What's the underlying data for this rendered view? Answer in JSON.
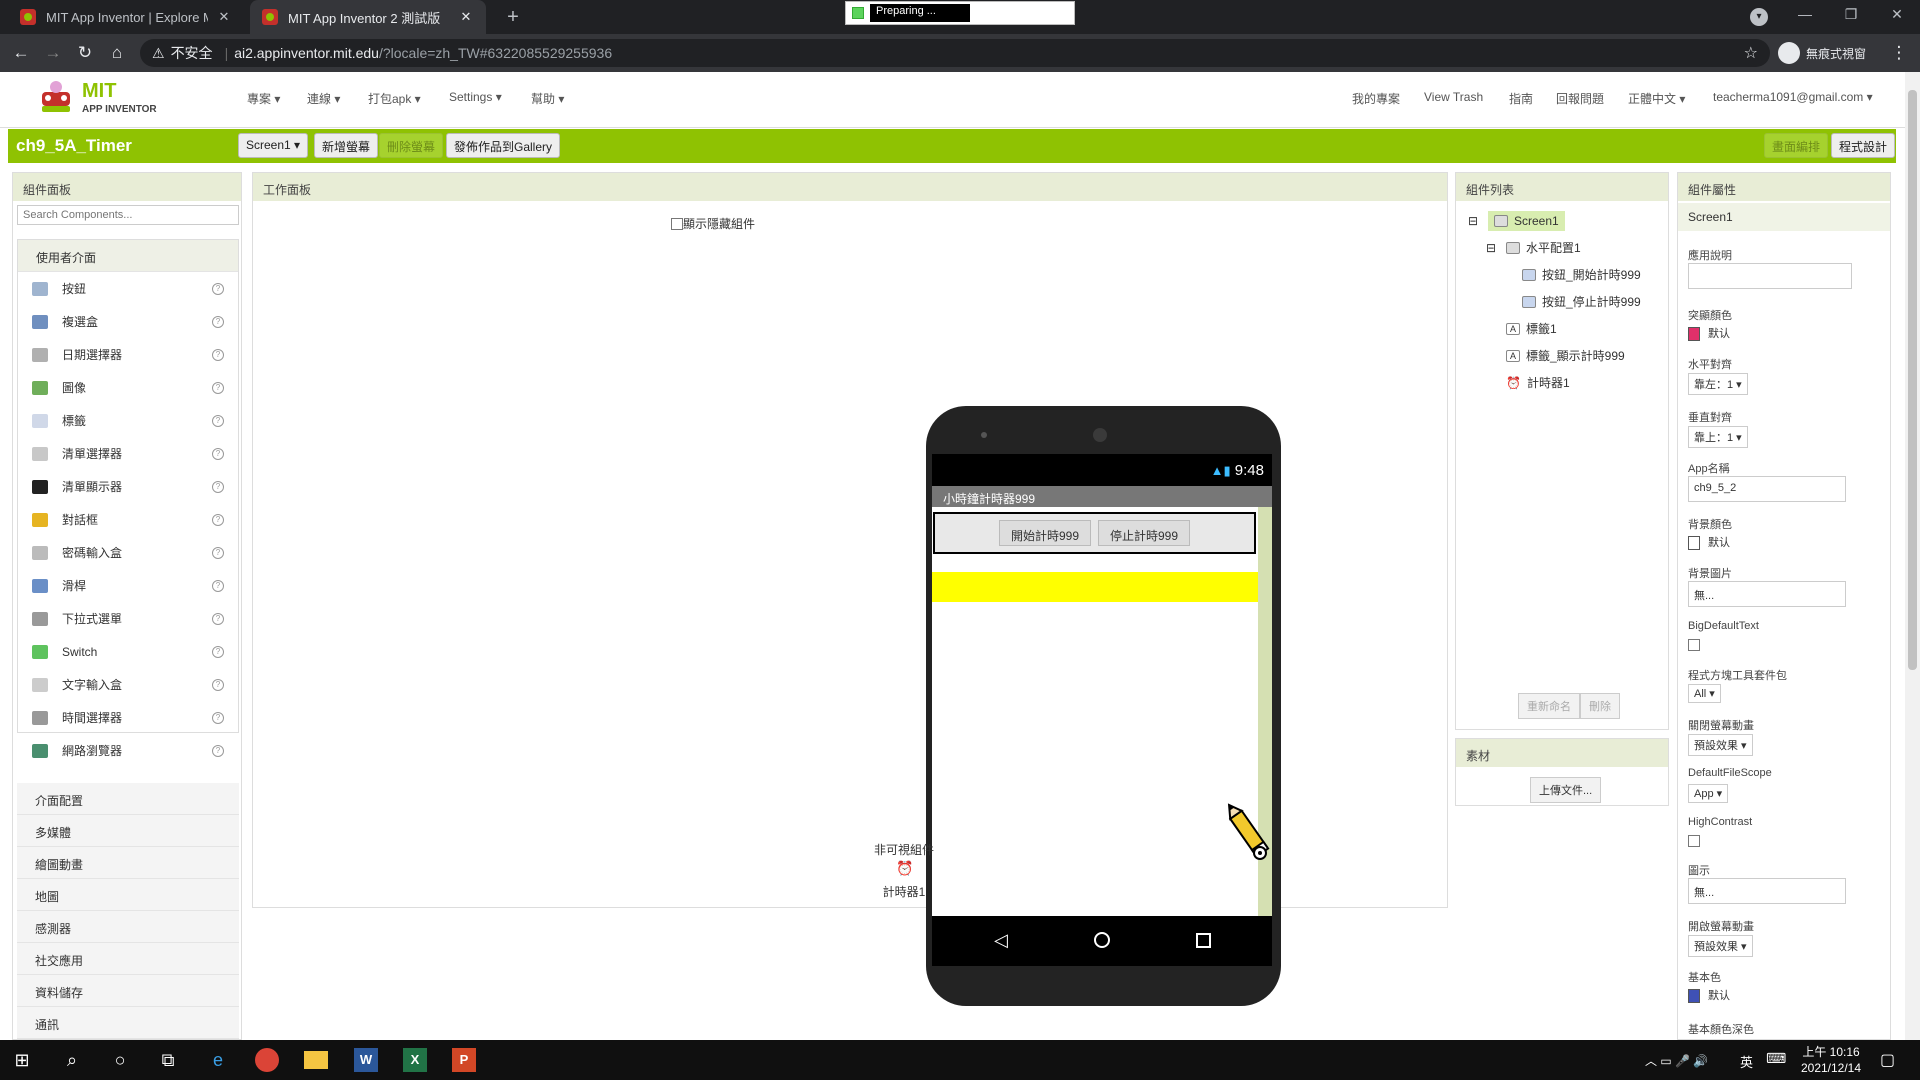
{
  "browser": {
    "tabs": [
      {
        "title": "MIT App Inventor | Explore MIT"
      },
      {
        "title": "MIT App Inventor 2 測試版"
      }
    ],
    "new_tab": "+",
    "preparing": "Preparing ...",
    "url_warning": "不安全",
    "url_host": "ai2.appinventor.mit.edu",
    "url_path": "/?locale=zh_TW#6322085529255936",
    "incognito": "無痕式視窗",
    "nav": {
      "back": "←",
      "forward": "→",
      "reload": "↻",
      "home": "⌂"
    },
    "star": "☆",
    "menu_dots": "⋮",
    "winctl": {
      "min": "—",
      "max": "❐",
      "close": "✕"
    }
  },
  "ai": {
    "logo_line1": "MIT",
    "logo_line2": "APP INVENTOR",
    "menu": [
      "專案 ▾",
      "連線 ▾",
      "打包apk ▾",
      "Settings ▾",
      "幫助 ▾"
    ],
    "right_menu": [
      "我的專案",
      "View Trash",
      "指南",
      "回報問題",
      "正體中文 ▾",
      "teacherma1091@gmail.com ▾"
    ],
    "project_name": "ch9_5A_Timer",
    "toolbar": {
      "screen_select": "Screen1 ▾",
      "add_screen": "新增螢幕",
      "remove_screen": "刪除螢幕",
      "publish": "發佈作品到Gallery",
      "designer": "畫面編排",
      "blocks": "程式設計"
    }
  },
  "palette": {
    "title": "組件面板",
    "search_placeholder": "Search Components...",
    "open_category": "使用者介面",
    "items": [
      {
        "label": "按鈕",
        "icon": "button-icon",
        "color": "#9fb4cf"
      },
      {
        "label": "複選盒",
        "icon": "checkbox-icon",
        "color": "#6f8fbf"
      },
      {
        "label": "日期選擇器",
        "icon": "datepicker-icon",
        "color": "#b0b0b0"
      },
      {
        "label": "圖像",
        "icon": "image-icon",
        "color": "#6fae5a"
      },
      {
        "label": "標籤",
        "icon": "label-icon",
        "color": "#d0d8e8"
      },
      {
        "label": "清單選擇器",
        "icon": "listpicker-icon",
        "color": "#c8c8c8"
      },
      {
        "label": "清單顯示器",
        "icon": "listview-icon",
        "color": "#222222"
      },
      {
        "label": "對話框",
        "icon": "notifier-icon",
        "color": "#e6b422"
      },
      {
        "label": "密碼輸入盒",
        "icon": "passwordbox-icon",
        "color": "#bbbbbb"
      },
      {
        "label": "滑桿",
        "icon": "slider-icon",
        "color": "#6a8fc7"
      },
      {
        "label": "下拉式選單",
        "icon": "spinner-icon",
        "color": "#999999"
      },
      {
        "label": "Switch",
        "icon": "switch-icon",
        "color": "#5ec35e"
      },
      {
        "label": "文字輸入盒",
        "icon": "textbox-icon",
        "color": "#cccccc"
      },
      {
        "label": "時間選擇器",
        "icon": "timepicker-icon",
        "color": "#999999"
      },
      {
        "label": "網路瀏覽器",
        "icon": "webviewer-icon",
        "color": "#4a8f6f"
      }
    ],
    "help_mark": "?",
    "categories": [
      "介面配置",
      "多媒體",
      "繪圖動畫",
      "地圖",
      "感測器",
      "社交應用",
      "資料儲存",
      "通訊"
    ]
  },
  "viewer": {
    "title": "工作面板",
    "show_hidden": "顯示隱藏組件",
    "status_time": "9:48",
    "app_title": "小時鐘計時器999",
    "button_start": "開始計時999",
    "button_stop": "停止計時999",
    "label_color": "#ffff00",
    "nonvisible_title": "非可視組件",
    "nonvisible_item": "計時器1"
  },
  "tree": {
    "title": "組件列表",
    "nodes": [
      {
        "label": "Screen1",
        "level": 0,
        "toggle": "⊟"
      },
      {
        "label": "水平配置1",
        "level": 1,
        "toggle": "⊟"
      },
      {
        "label": "按鈕_開始計時999",
        "level": 2
      },
      {
        "label": "按鈕_停止計時999",
        "level": 2
      },
      {
        "label": "標籤1",
        "level": 1
      },
      {
        "label": "標籤_顯示計時999",
        "level": 1
      },
      {
        "label": "計時器1",
        "level": 1
      }
    ],
    "rename": "重新命名",
    "delete": "刪除"
  },
  "media": {
    "title": "素材",
    "upload": "上傳文件..."
  },
  "properties": {
    "title": "組件屬性",
    "component": "Screen1",
    "about_label": "應用說明",
    "accent_label": "突顯顏色",
    "accent_value": "默认",
    "accent_color": "#e0306a",
    "halign_label": "水平對齊",
    "halign_value": "靠左：1 ▾",
    "valign_label": "垂直對齊",
    "valign_value": "靠上：1 ▾",
    "appname_label": "App名稱",
    "appname_value": "ch9_5_2",
    "bgcolor_label": "背景顏色",
    "bgcolor_value": "默认",
    "bgimage_label": "背景圖片",
    "bgimage_value": "無...",
    "bigtext_label": "BigDefaultText",
    "blocks_toolkit_label": "程式方塊工具套件包",
    "blocks_toolkit_value": "All ▾",
    "close_anim_label": "關閉螢幕動畫",
    "close_anim_value": "預設效果 ▾",
    "filescope_label": "DefaultFileScope",
    "filescope_value": "App ▾",
    "highcontrast_label": "HighContrast",
    "icon_label": "圖示",
    "icon_value": "無...",
    "open_anim_label": "開啟螢幕動畫",
    "open_anim_value": "預設效果 ▾",
    "primary_label": "基本色",
    "primary_value": "默认",
    "primary_color": "#3f51b5",
    "primary_dark_label": "基本顏色深色"
  },
  "taskbar": {
    "ime": "英",
    "time": "上午 10:16",
    "date": "2021/12/14"
  }
}
